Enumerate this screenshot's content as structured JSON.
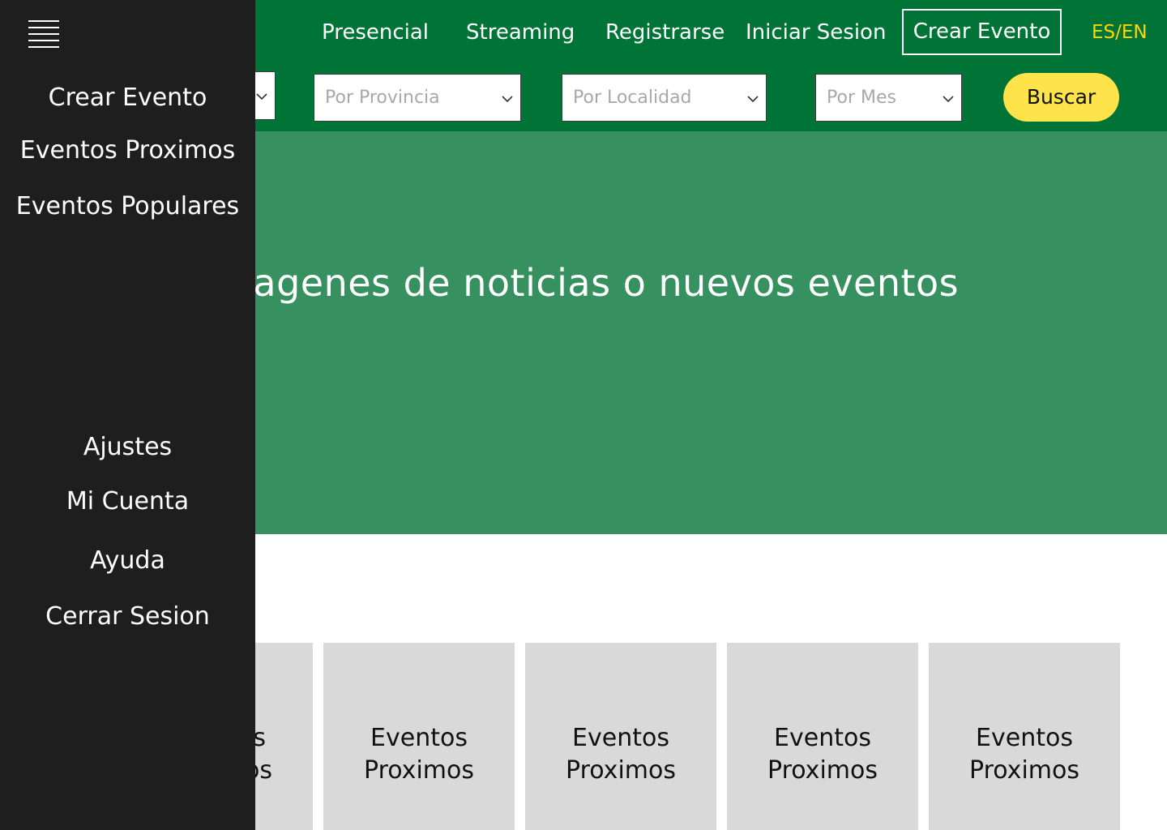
{
  "header": {
    "nav": {
      "presencial": "Presencial",
      "streaming": "Streaming",
      "registrarse": "Registrarse",
      "iniciar_sesion": "Iniciar Sesion",
      "crear_evento": "Crear Evento",
      "lang": "ES/EN"
    },
    "filters": {
      "provincia_placeholder": "Por Provincia",
      "localidad_placeholder": "Por Localidad",
      "mes_placeholder": "Por Mes",
      "buscar_label": "Buscar"
    }
  },
  "hero": {
    "text": "Imagenes de noticias o nuevos eventos"
  },
  "cards": [
    {
      "line1": "Eventos",
      "line2": "Proximos"
    },
    {
      "line1": "Eventos",
      "line2": "Proximos"
    },
    {
      "line1": "Eventos",
      "line2": "Proximos"
    },
    {
      "line1": "Eventos",
      "line2": "Proximos"
    },
    {
      "line1": "Eventos",
      "line2": "Proximos"
    }
  ],
  "sidebar": {
    "menu_icon": "hamburger-icon",
    "items_top": [
      "Crear Evento",
      "Eventos Proximos",
      "Eventos Populares"
    ],
    "items_bottom": [
      "Ajustes",
      "Mi Cuenta",
      "Ayuda",
      "Cerrar Sesion"
    ]
  },
  "colors": {
    "header_green": "#007436",
    "hero_green": "#37905f",
    "accent_yellow": "#ffe34a",
    "lang_yellow": "#ffd500",
    "sidebar_bg": "#1e1e1e",
    "card_gray": "#d9d9d9"
  }
}
